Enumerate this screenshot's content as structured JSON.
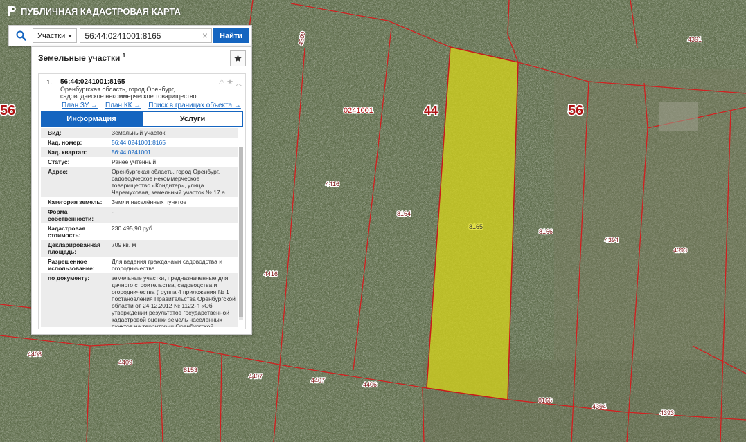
{
  "app": {
    "title": "ПУБЛИЧНАЯ КАДАСТРОВАЯ КАРТА"
  },
  "search": {
    "type_label": "Участки",
    "query": "56:44:0241001:8165",
    "clear_glyph": "×",
    "button_label": "Найти"
  },
  "panel": {
    "title": "Земельные участки",
    "count": "1",
    "result": {
      "index": "1.",
      "cad_number": "56:44:0241001:8165",
      "address_short": "Оренбургская область, город Оренбург, садоводческое некоммерческое товарищество…",
      "links": [
        "План ЗУ →",
        "План КК →",
        "Поиск в границах объекта →"
      ]
    },
    "tabs": {
      "info": "Информация",
      "services": "Услуги"
    },
    "fields": [
      {
        "key": "Вид:",
        "value": "Земельный участок",
        "link": false
      },
      {
        "key": "Кад. номер:",
        "value": "56:44:0241001:8165",
        "link": true
      },
      {
        "key": "Кад. квартал:",
        "value": "56:44:0241001",
        "link": true
      },
      {
        "key": "Статус:",
        "value": "Ранее учтенный",
        "link": false
      },
      {
        "key": "Адрес:",
        "value": "Оренбургская область, город Оренбург, садоводческое некоммерческое товарищество «Кондитер», улица Черемуховая, земельный участок № 17 а",
        "link": false
      },
      {
        "key": "Категория земель:",
        "value": "Земли населённых пунктов",
        "link": false
      },
      {
        "key": "Форма собственности:",
        "value": "-",
        "link": false
      },
      {
        "key": "Кадастровая стоимость:",
        "value": "230 495,90 руб.",
        "link": false
      },
      {
        "key": "Декларированная площадь:",
        "value": "709 кв. м",
        "link": false
      },
      {
        "key": "Разрешенное использование:",
        "value": "Для ведения гражданами садоводства и огородничества",
        "link": false
      },
      {
        "key": "по документу:",
        "value": "земельные участки, предназначенные для дачного строительства, садоводства и огородничества (группа 4 приложения № 1 постановления Правительства Оренбургской области от 24.12.2012 № 1122-п «Об утверждении результатов государственной кадастровой оценки земель населенных пунктов на территории Оренбургской области»)",
        "link": false
      }
    ]
  },
  "map": {
    "region_labels": [
      "56",
      "44",
      "56",
      "0241001"
    ],
    "parcel_labels": [
      "4391",
      "4416",
      "8164",
      "8165",
      "8166",
      "4394",
      "4393",
      "4416",
      "4408",
      "4409",
      "8153",
      "4407",
      "4407",
      "4406",
      "8166",
      "4394",
      "4393",
      "4300"
    ],
    "colors": {
      "boundary": "#d21f1f",
      "selected_fill": "#d6d41a",
      "selected_stroke": "#c71b1b",
      "accent": "#1565c0"
    }
  }
}
